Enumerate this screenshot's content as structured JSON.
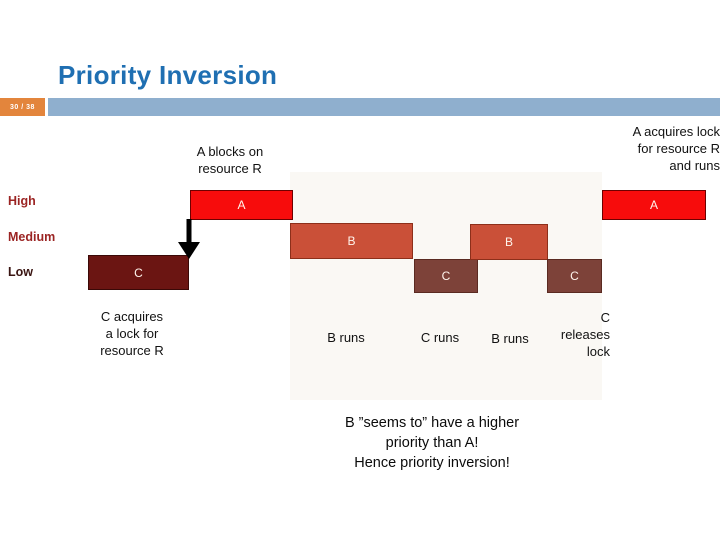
{
  "slide": {
    "title": "Priority Inversion",
    "page_badge": "30 / 38",
    "accent_blue": "#1F6FB2",
    "strip_blue": "#8FAFCE",
    "badge_orange": "#E3853C"
  },
  "priority_rows": {
    "high": "High",
    "medium": "Medium",
    "low": "Low"
  },
  "bars": [
    {
      "label": "A",
      "task": "A",
      "priority": "High",
      "order": 1,
      "color": "#F70C0C"
    },
    {
      "label": "B",
      "task": "B",
      "priority": "Medium",
      "order": 2,
      "color": "#CA5038"
    },
    {
      "label": "C",
      "task": "C",
      "priority": "Low",
      "order": 3,
      "color": "#7D4239"
    },
    {
      "label": "B",
      "task": "B",
      "priority": "Medium",
      "order": 4,
      "color": "#CA5038"
    },
    {
      "label": "C",
      "task": "C",
      "priority": "Low",
      "order": 5,
      "color": "#7D4239"
    },
    {
      "label": "A",
      "task": "A",
      "priority": "High",
      "order": 6,
      "color": "#F70C0C"
    },
    {
      "label": "C",
      "task": "C",
      "priority": "Low",
      "order": 0,
      "color": "#6B1512"
    }
  ],
  "annotations": {
    "a_blocks": "A blocks on\nresource R",
    "a_acquires": "A acquires lock\nfor resource R\nand runs",
    "c_acquires": "C acquires\na lock for\nresource R",
    "b_runs_first": "B runs",
    "c_runs": "C runs",
    "b_runs_second": "B runs",
    "c_releases": "C\nreleases\nlock"
  },
  "caption": "B ”seems to” have a higher\npriority than A!\nHence priority inversion!"
}
